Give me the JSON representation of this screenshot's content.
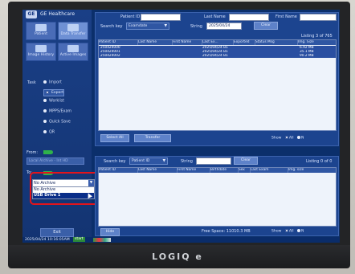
{
  "header": {
    "brand": "GE Healthcare"
  },
  "tiles": [
    {
      "label": "Patient"
    },
    {
      "label": "Data Transfer"
    },
    {
      "label": "Image History"
    },
    {
      "label": "Active Images"
    }
  ],
  "task": {
    "label": "Task",
    "options": [
      {
        "label": "Import",
        "selected": false
      },
      {
        "label": "Export",
        "selected": true
      },
      {
        "label": "Worklist",
        "selected": false
      },
      {
        "label": "MPPS/Exam",
        "selected": false
      },
      {
        "label": "Quick Save",
        "selected": false
      },
      {
        "label": "QR",
        "selected": false
      }
    ]
  },
  "from": {
    "label": "From:",
    "value": "Local Archive - Int HD"
  },
  "to": {
    "label": "To:"
  },
  "archive_dropdown": {
    "value": "No Archive",
    "options": [
      "No Archive",
      "USB Drive 1"
    ],
    "highlighted": "USB Drive 1"
  },
  "exit_label": "Exit",
  "top": {
    "patient_id_label": "Patient ID",
    "last_name_label": "Last Name",
    "first_name_label": "First Name",
    "search_key_label": "Search key",
    "search_key_value": "Examdate",
    "string_label": "String",
    "string_value": "2025/04/24",
    "clear_label": "Clear",
    "listing": "Listing 3 of 765",
    "columns": [
      "Patient ID",
      "Last Name",
      "First Name",
      "Last Ex...",
      "Exported",
      "Status Msg",
      "Img. Size"
    ],
    "rows": [
      {
        "id": "250424000",
        "last": "",
        "first": "",
        "date": "2025/04/24 B1",
        "exported": "",
        "status": "",
        "size": "6.92 MB"
      },
      {
        "id": "250424001",
        "last": "",
        "first": "",
        "date": "2025/04/24 B1",
        "exported": "",
        "status": "",
        "size": "35.1 MB"
      },
      {
        "id": "250424002",
        "last": "",
        "first": "",
        "date": "2025/04/24 B1",
        "exported": "",
        "status": "",
        "size": "90.2 MB"
      }
    ],
    "select_all_label": "Select All",
    "transfer_label": "Transfer",
    "show_label": "Show",
    "show_all_label": "All",
    "show_none_label": "N"
  },
  "bottom": {
    "search_key_label": "Search key",
    "search_key_value": "Patient ID",
    "string_label": "String",
    "clear_label": "Clear",
    "listing": "Listing 0 of 0",
    "columns": [
      "Patient ID",
      "Last Name",
      "First Name",
      "Birthdate",
      "Sex",
      "Last Exam",
      "Img. size"
    ],
    "hide_label": "Hide",
    "free_space": "Free Space: 11010.3 MB",
    "show_label": "Show",
    "show_all_label": "All",
    "show_none_label": "N"
  },
  "taskbar": {
    "clock": "2025/04/24 10:16:05AM",
    "start_label": "start"
  },
  "monitor": {
    "brand": "LOGIQ e"
  }
}
